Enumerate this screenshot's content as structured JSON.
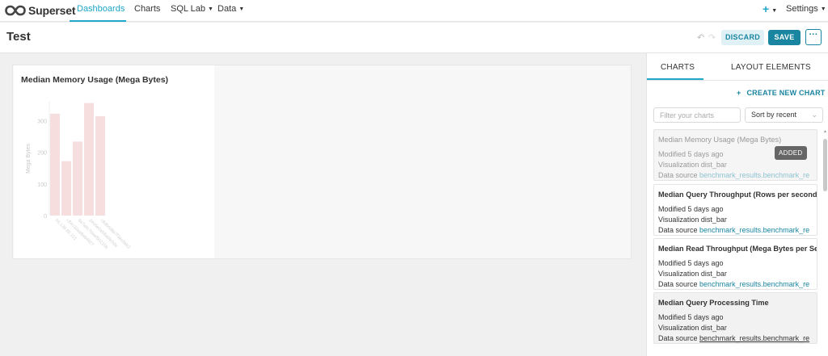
{
  "app": {
    "brand": "Superset"
  },
  "nav": {
    "dashboards": "Dashboards",
    "charts": "Charts",
    "sql_lab": "SQL Lab",
    "data": "Data",
    "plus": "+",
    "settings": "Settings"
  },
  "header": {
    "title": "Test",
    "discard_label": "DISCARD",
    "save_label": "SAVE",
    "more_label": "···"
  },
  "chart_card": {
    "title": "Median Memory Usage (Mega Bytes)"
  },
  "chart_data": {
    "type": "bar",
    "title": "Median Memory Usage (Mega Bytes)",
    "ylabel": "Mega Bytes",
    "xlabel": "",
    "ylim": [
      0,
      360
    ],
    "yticks": [
      0,
      100,
      200,
      300
    ],
    "categories": [
      "93.139.85.101",
      "c84c32aa8a84927",
      "9a7a9c7deef50210b",
      "2ec6e0a58a6fe5da",
      "c8db4d8a7f3ec8ab2"
    ],
    "values": [
      322,
      172,
      234,
      356,
      314
    ],
    "bar_color": "#f7dede"
  },
  "panel": {
    "tab_charts": "CHARTS",
    "tab_layout": "LAYOUT ELEMENTS",
    "create_new": "CREATE NEW CHART",
    "filter_placeholder": "Filter your charts",
    "sort_value": "Sort by recent",
    "added_badge": "ADDED",
    "items": [
      {
        "title": "Median Memory Usage (Mega Bytes)",
        "modified": "Modified 5 days ago",
        "viz": "Visualization dist_bar",
        "source_label": "Data source",
        "source": "benchmark_results.benchmark_re"
      },
      {
        "title": "Median Query Throughput (Rows per second",
        "modified": "Modified 5 days ago",
        "viz": "Visualization dist_bar",
        "source_label": "Data source",
        "source": "benchmark_results.benchmark_re"
      },
      {
        "title": "Median Read Throughput (Mega Bytes per Se",
        "modified": "Modified 5 days ago",
        "viz": "Visualization dist_bar",
        "source_label": "Data source",
        "source": "benchmark_results.benchmark_re"
      },
      {
        "title": "Median Query Processing Time",
        "modified": "Modified 5 days ago",
        "viz": "Visualization dist_bar",
        "source_label": "Data source",
        "source": "benchmark_results.benchmark_re"
      }
    ]
  },
  "colors": {
    "accent": "#20a7c9",
    "primary": "#1a85a0"
  }
}
